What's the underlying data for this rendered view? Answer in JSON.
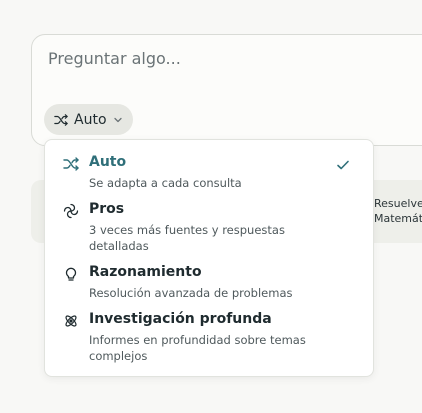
{
  "search": {
    "placeholder": "Preguntar algo..."
  },
  "mode_button": {
    "label": "Auto",
    "icon": "shuffle-icon"
  },
  "background_card": {
    "line1": "Resuelve",
    "line2": "Matemátic"
  },
  "dropdown": {
    "options": [
      {
        "title": "Auto",
        "description": "Se adapta a cada consulta",
        "icon": "shuffle-icon",
        "selected": true
      },
      {
        "title": "Pros",
        "description": "3 veces más fuentes y respuestas detalladas",
        "icon": "swirl-icon",
        "selected": false
      },
      {
        "title": "Razonamiento",
        "description": "Resolución avanzada de problemas",
        "icon": "lightbulb-icon",
        "selected": false
      },
      {
        "title": "Investigación profunda",
        "description": "Informes en profundidad sobre temas complejos",
        "icon": "atom-icon",
        "selected": false
      }
    ]
  },
  "colors": {
    "accent": "#2f6f79",
    "background": "#f8f8f6",
    "button_bg": "#e6e7e2"
  }
}
